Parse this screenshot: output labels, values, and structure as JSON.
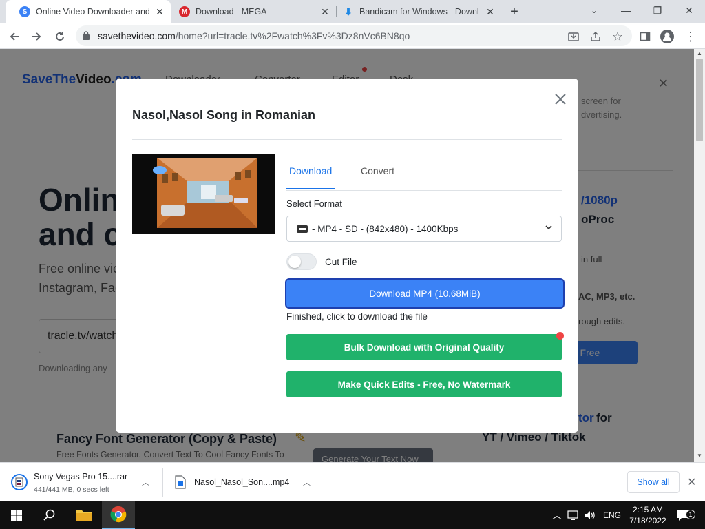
{
  "browser": {
    "tabs": [
      {
        "title": "Online Video Downloader and Co",
        "favicon": "savethevideo-s-icon",
        "active": true
      },
      {
        "title": "Download - MEGA",
        "favicon": "mega-icon",
        "active": false
      },
      {
        "title": "Bandicam for Windows - Downlo",
        "favicon": "bandicam-icon",
        "active": false
      }
    ],
    "url_host": "savethevideo.com",
    "url_path": "/home?url=tracle.tv%2Fwatch%3Fv%3Dz8nVc6BN8qo"
  },
  "background_page": {
    "logo_a": "SaveThe",
    "logo_b": "Video",
    "logo_c": ".com",
    "nav": [
      "Downloader",
      "Converter",
      "Editor",
      "Desk"
    ],
    "hero_line1": "Onlin",
    "hero_line2": "and c",
    "sub_line1": "Free online vic",
    "sub_line2": "Instagram, Fac",
    "input_value": "tracle.tv/watch",
    "downloading_text": "Downloading any",
    "right_text1": "screen for",
    "right_text2": "dvertising.",
    "right_1080": "/1080p",
    "right_proc": "oProc",
    "right_full": "in full",
    "right_formats": "AC, MP3, etc.",
    "right_edits": "rough edits.",
    "right_free": "r Free",
    "right_tor": "tor",
    "right_for": "for",
    "right_yt": "YT / Vimeo / Tiktok",
    "fancy_title": "Fancy Font Generator (Copy & Paste)",
    "fancy_sub": "Free Fonts Generator. Convert Text To Cool Fancy Fonts To",
    "fancy_btn": "Generate Your Text Now"
  },
  "modal": {
    "title": "Nasol,Nasol Song in Romanian",
    "tabs": [
      "Download",
      "Convert"
    ],
    "select_label": "Select Format",
    "selected_format": "- MP4 - SD - (842x480) - 1400Kbps",
    "cut_file_label": "Cut File",
    "download_button": "Download MP4 (10.68MiB)",
    "status": "Finished, click to download the file",
    "bulk_button": "Bulk Download with Original Quality",
    "edits_button": "Make Quick Edits - Free, No Watermark"
  },
  "downloads": {
    "items": [
      {
        "name": "Sony Vegas Pro 15....rar",
        "status": "441/441 MB, 0 secs left"
      },
      {
        "name": "Nasol_Nasol_Son....mp4",
        "status": ""
      }
    ],
    "show_all": "Show all"
  },
  "taskbar": {
    "lang": "ENG",
    "time": "2:15 AM",
    "date": "7/18/2022",
    "notif_count": "1"
  },
  "colors": {
    "accent": "#3b82f6",
    "green": "#20b26b",
    "tab_active": "#1a73e8"
  }
}
